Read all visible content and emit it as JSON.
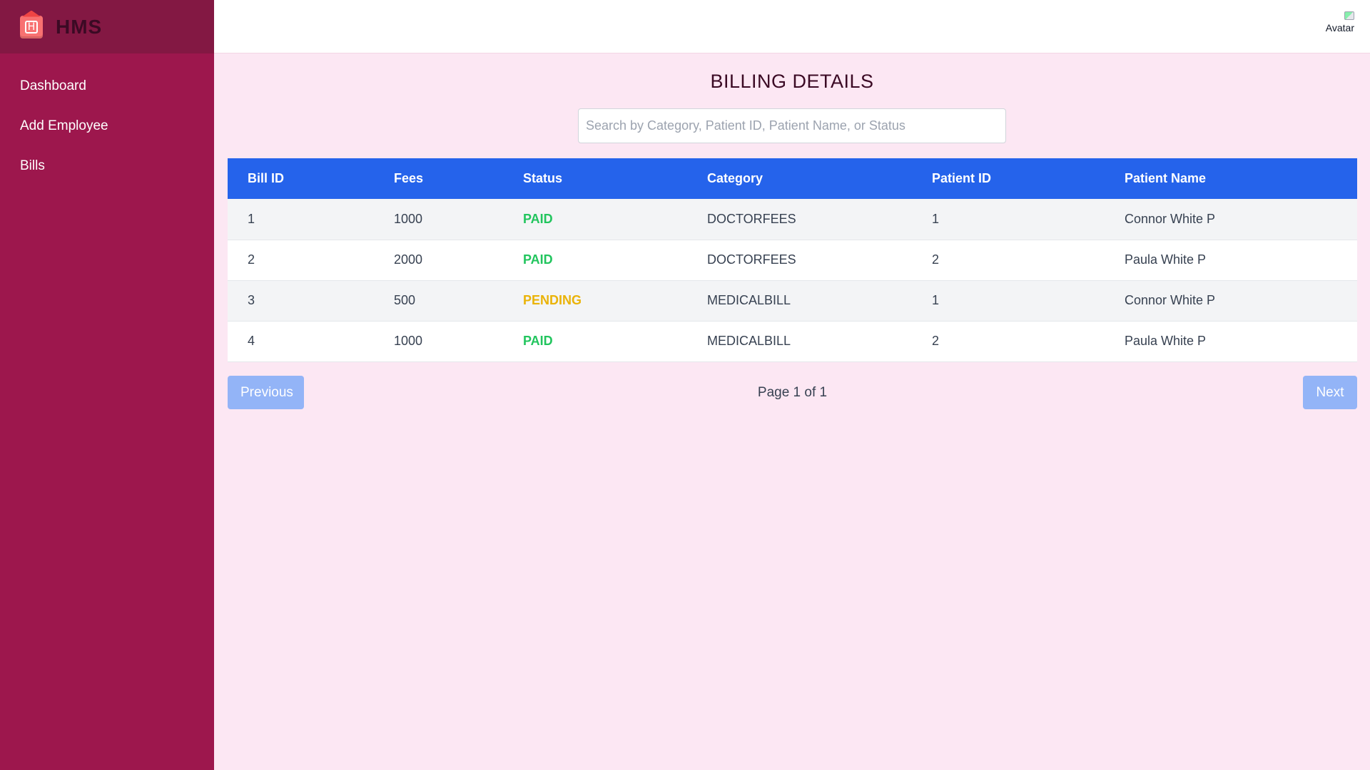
{
  "brand": {
    "name": "HMS",
    "logo_letter": "H"
  },
  "sidebar": {
    "items": [
      {
        "label": "Dashboard"
      },
      {
        "label": "Add Employee"
      },
      {
        "label": "Bills"
      }
    ]
  },
  "topbar": {
    "avatar_alt": "Avatar"
  },
  "main": {
    "title": "BILLING DETAILS",
    "search": {
      "value": "",
      "placeholder": "Search by Category, Patient ID, Patient Name, or Status"
    }
  },
  "table": {
    "columns": [
      "Bill ID",
      "Fees",
      "Status",
      "Category",
      "Patient ID",
      "Patient Name"
    ],
    "rows": [
      {
        "bill_id": "1",
        "fees": "1000",
        "status": "PAID",
        "category": "DOCTORFEES",
        "patient_id": "1",
        "patient_name": "Connor White P"
      },
      {
        "bill_id": "2",
        "fees": "2000",
        "status": "PAID",
        "category": "DOCTORFEES",
        "patient_id": "2",
        "patient_name": "Paula White P"
      },
      {
        "bill_id": "3",
        "fees": "500",
        "status": "PENDING",
        "category": "MEDICALBILL",
        "patient_id": "1",
        "patient_name": "Connor White P"
      },
      {
        "bill_id": "4",
        "fees": "1000",
        "status": "PAID",
        "category": "MEDICALBILL",
        "patient_id": "2",
        "patient_name": "Paula White P"
      }
    ]
  },
  "pagination": {
    "previous_label": "Previous",
    "next_label": "Next",
    "page_info": "Page 1 of 1"
  },
  "colors": {
    "sidebar": "#9d174d",
    "brand_bar": "#831843",
    "table_header": "#2563eb",
    "page_bg": "#fce7f3",
    "paid": "#22c55e",
    "pending": "#eab308"
  }
}
